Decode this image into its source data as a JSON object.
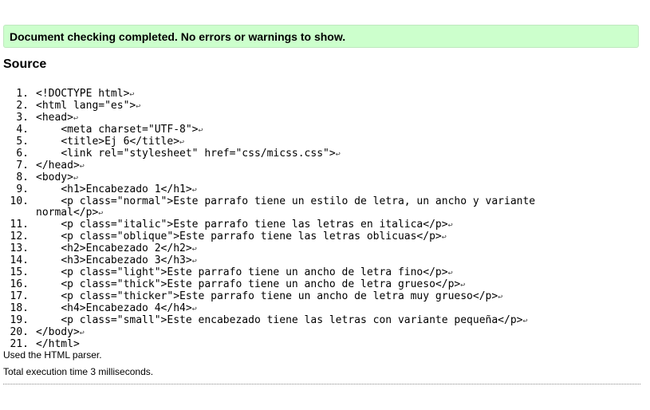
{
  "status": {
    "message": "Document checking completed. No errors or warnings to show."
  },
  "source": {
    "heading": "Source",
    "eol_marker": "↩",
    "lines": [
      {
        "number": "1.",
        "text": "<!DOCTYPE html>"
      },
      {
        "number": "2.",
        "text": "<html lang=\"es\">"
      },
      {
        "number": "3.",
        "text": "<head>"
      },
      {
        "number": "4.",
        "text": "    <meta charset=\"UTF-8\">"
      },
      {
        "number": "5.",
        "text": "    <title>Ej 6</title>"
      },
      {
        "number": "6.",
        "text": "    <link rel=\"stylesheet\" href=\"css/micss.css\">"
      },
      {
        "number": "7.",
        "text": "</head>"
      },
      {
        "number": "8.",
        "text": "<body>"
      },
      {
        "number": "9.",
        "text": "    <h1>Encabezado 1</h1>"
      },
      {
        "number": "10.",
        "text": "    <p class=\"normal\">Este parrafo tiene un estilo de letra, un ancho y variante normal</p>"
      },
      {
        "number": "11.",
        "text": "    <p class=\"italic\">Este parrafo tiene las letras en italica</p>"
      },
      {
        "number": "12.",
        "text": "    <p class=\"oblique\">Este parrafo tiene las letras oblicuas</p>"
      },
      {
        "number": "13.",
        "text": "    <h2>Encabezado 2</h2>"
      },
      {
        "number": "14.",
        "text": "    <h3>Encabezado 3</h3>"
      },
      {
        "number": "15.",
        "text": "    <p class=\"light\">Este parrafo tiene un ancho de letra fino</p>"
      },
      {
        "number": "16.",
        "text": "    <p class=\"thick\">Este parrafo tiene un ancho de letra grueso</p>"
      },
      {
        "number": "17.",
        "text": "    <p class=\"thicker\">Este parrafo tiene un ancho de letra muy grueso</p>"
      },
      {
        "number": "18.",
        "text": "    <h4>Encabezado 4</h4>"
      },
      {
        "number": "19.",
        "text": "    <p class=\"small\">Este encabezado tiene las letras con variante pequeña</p>"
      },
      {
        "number": "20.",
        "text": "</body>"
      },
      {
        "number": "21.",
        "text": "</html>",
        "no_eol": true
      }
    ]
  },
  "footer": {
    "parser_note": "Used the HTML parser.",
    "timing_note": "Total execution time 3 milliseconds."
  },
  "colors": {
    "success_background": "#ccffcc",
    "success_border": "#bfe8bf"
  }
}
